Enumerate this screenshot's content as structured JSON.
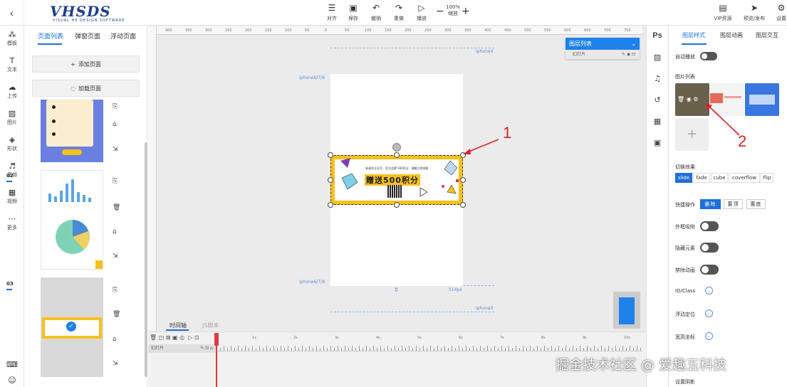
{
  "header": {
    "tools": [
      {
        "label": "对齐",
        "icon": "align-icon"
      },
      {
        "label": "保存",
        "icon": "save-icon"
      },
      {
        "label": "撤销",
        "icon": "undo-icon"
      },
      {
        "label": "重做",
        "icon": "redo-icon"
      },
      {
        "label": "播放",
        "icon": "play-icon"
      }
    ],
    "zoom_value": "100%",
    "zoom_label": "缩放",
    "right_tools": [
      {
        "label": "VIP资源",
        "icon": "vip-icon"
      },
      {
        "label": "预览/发布",
        "icon": "publish-icon"
      },
      {
        "label": "设置",
        "icon": "gear-icon"
      }
    ],
    "logo_text": "VHSDS",
    "logo_sub": "VISUAL H5 DESIGN SOFTWARE"
  },
  "rail": {
    "items": [
      {
        "label": "模板",
        "icon": "template-icon"
      },
      {
        "label": "文本",
        "icon": "text-icon"
      },
      {
        "label": "上传",
        "icon": "upload-icon"
      },
      {
        "label": "图片",
        "icon": "image-icon"
      },
      {
        "label": "形状",
        "icon": "shape-icon"
      },
      {
        "label": "音频",
        "icon": "audio-icon"
      },
      {
        "label": "视频",
        "icon": "video-icon"
      },
      {
        "label": "更多",
        "icon": "more-icon"
      }
    ]
  },
  "page_panel": {
    "tabs": [
      "页面列表",
      "弹窗页面",
      "浮动页面"
    ],
    "add_page": "添加页面",
    "load_page": "加载页面",
    "pages": [
      "02",
      "03"
    ]
  },
  "canvas": {
    "device_label_top": "iphoneX",
    "device_label_page": "iphone6/7/8",
    "device_label_page_bottom": "iphone6/7/8",
    "device_label_bottom": "iphoneX",
    "width_label": "514px",
    "banner_line": "来源名企业号 · 官方品牌 500积分 · 满额立即领取",
    "banner_title": "赠送500积分",
    "ruler_labels": [
      "400",
      "350",
      "300",
      "250",
      "200",
      "150",
      "100",
      "50",
      "0",
      "50",
      "100",
      "150",
      "200",
      "250",
      "300",
      "350",
      "400",
      "450",
      "500",
      "550",
      "600",
      "650",
      "700",
      "750"
    ]
  },
  "layers": {
    "title": "图层列表",
    "row": "幻灯片"
  },
  "timeline": {
    "tabs": [
      "时间轴",
      "JS脚本"
    ],
    "row": "幻灯片",
    "marks": [
      "1s",
      "2s",
      "3s",
      "4s",
      "5s",
      "6s",
      "7s",
      "8s",
      "9s",
      "10s"
    ]
  },
  "props": {
    "tabs": [
      "图层样式",
      "图层动画",
      "图层交互"
    ],
    "autoplay": "自动播放",
    "image_list": "图片列表",
    "switch_effect": "切换效果",
    "effects": [
      "slide",
      "fade",
      "cube",
      "coverflow",
      "flip"
    ],
    "quick_ops": "快捷操作",
    "quick_buttons": [
      "删除",
      "置顶",
      "置底"
    ],
    "outer_adsorb": "外框吸附",
    "hide_element": "隐藏元素",
    "disable_anim": "禁除动画",
    "id_class": "ID/Class",
    "float_pos": "浮动定位",
    "size_coord": "宽高坐标",
    "set_shadow": "设置阴影"
  },
  "annotations": [
    "1",
    "2"
  ],
  "watermark": "掘金技术社区 @ 爱趣五科技",
  "colors": {
    "accent": "#1e6fd9",
    "banner": "#f7c11c",
    "annotation": "#d8232a",
    "layer_head": "#1e82ea"
  }
}
